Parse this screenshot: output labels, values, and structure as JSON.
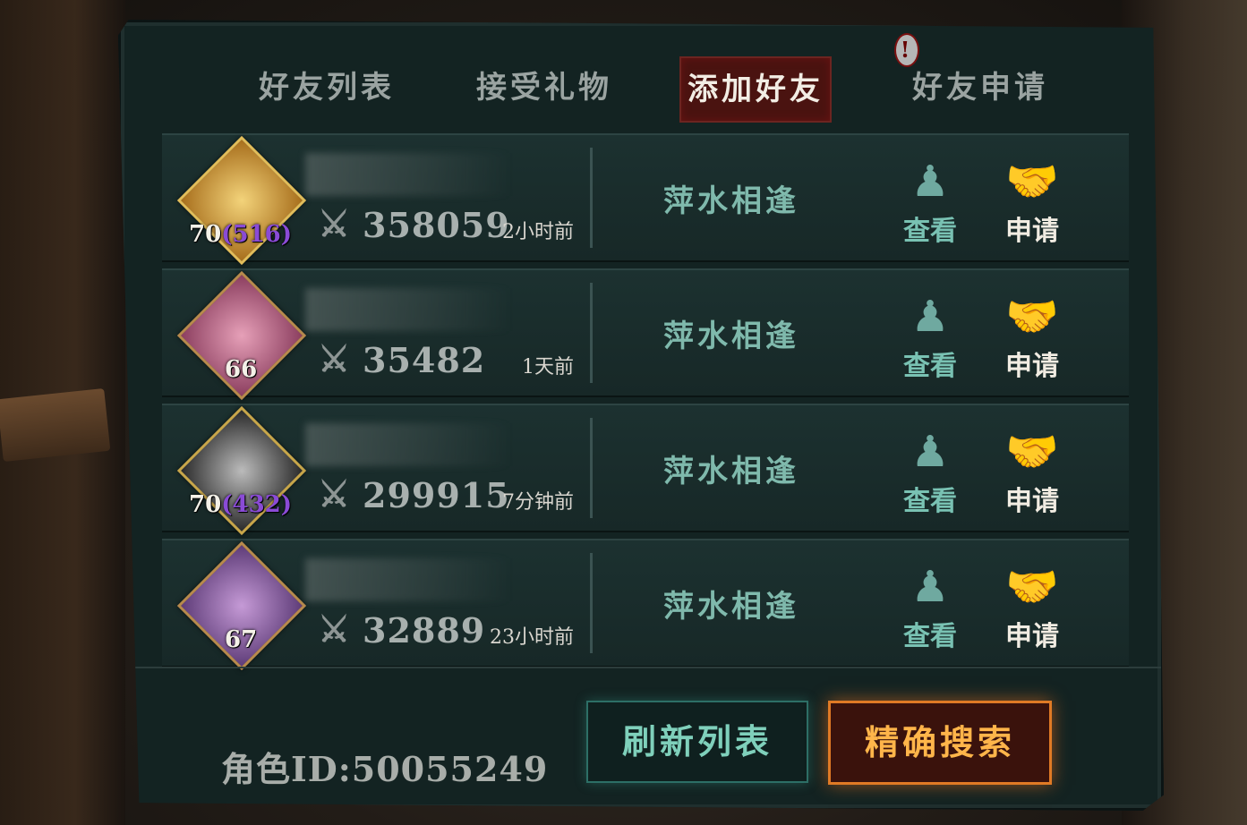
{
  "tabs": [
    {
      "label": "好友列表",
      "active": false
    },
    {
      "label": "接受礼物",
      "active": false
    },
    {
      "label": "添加好友",
      "active": true
    },
    {
      "label": "好友申请",
      "active": false,
      "alert": "!"
    }
  ],
  "rows": [
    {
      "level": "70",
      "vip": "(516)",
      "power": "358059",
      "time": "2小时前",
      "status": "萍水相逢",
      "view": "查看",
      "apply": "申请"
    },
    {
      "level": "66",
      "vip": "",
      "power": "35482",
      "time": "1天前",
      "status": "萍水相逢",
      "view": "查看",
      "apply": "申请"
    },
    {
      "level": "70",
      "vip": "(432)",
      "power": "299915",
      "time": "7分钟前",
      "status": "萍水相逢",
      "view": "查看",
      "apply": "申请"
    },
    {
      "level": "67",
      "vip": "",
      "power": "32889",
      "time": "23小时前",
      "status": "萍水相逢",
      "view": "查看",
      "apply": "申请"
    }
  ],
  "footer": {
    "role_id": "角色ID:50055249",
    "refresh_label": "刷新列表",
    "search_label": "精确搜索"
  },
  "icons": {
    "power": "crossed-swords-icon",
    "view": "figure-icon",
    "apply": "handshake-icon"
  },
  "colors": {
    "active_tab_bg": "#4a1310",
    "vip_purple": "#8a4bd6",
    "status_teal": "#7fb9ac",
    "search_orange": "#ffb54a"
  }
}
